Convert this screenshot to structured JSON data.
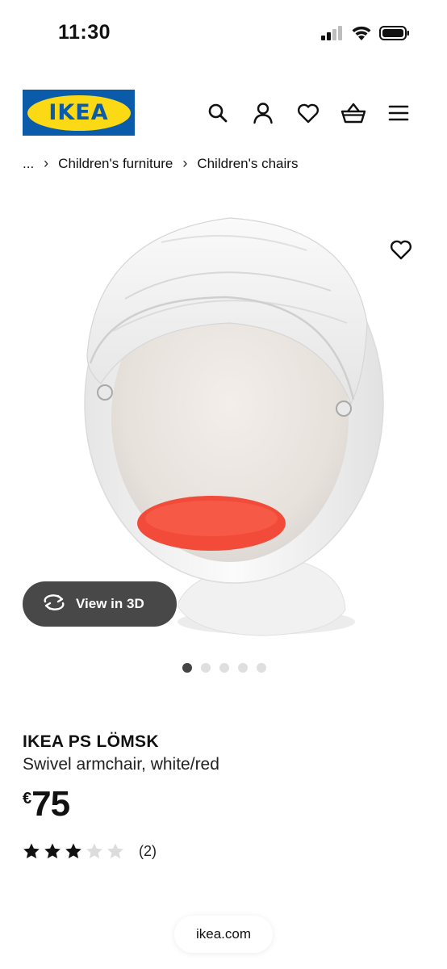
{
  "status_bar": {
    "time": "11:30",
    "icons": [
      "signal-icon",
      "wifi-icon",
      "battery-icon"
    ]
  },
  "header": {
    "logo_text": "IKEA",
    "icons": [
      "search-icon",
      "account-icon",
      "heart-icon",
      "basket-icon",
      "menu-icon"
    ],
    "brand_colors": {
      "blue": "#0a5ba9",
      "yellow": "#fbd914"
    }
  },
  "breadcrumb": {
    "ellipsis": "...",
    "items": [
      "Children's furniture",
      "Children's chairs"
    ]
  },
  "gallery": {
    "view_3d_label": "View in 3D",
    "image_count": 5,
    "active_index": 0
  },
  "product": {
    "name": "IKEA PS LÖMSK",
    "description": "Swivel armchair, white/red",
    "currency": "€",
    "price": "75",
    "rating_value": 3,
    "rating_max": 5,
    "review_count": "(2)"
  },
  "browser": {
    "url": "ikea.com"
  }
}
